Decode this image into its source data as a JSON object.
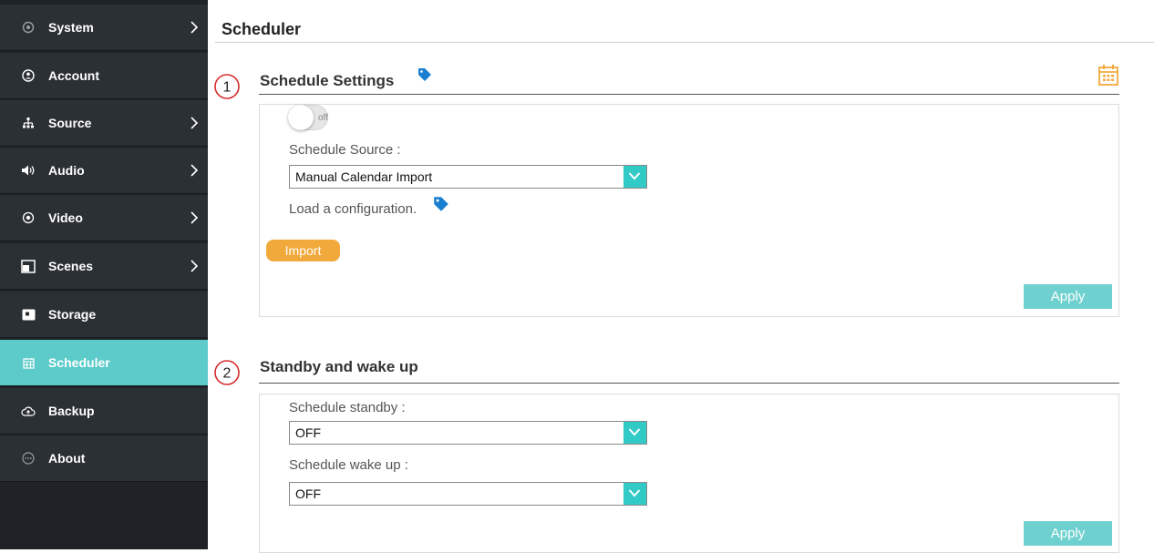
{
  "sidebar": {
    "items": [
      {
        "label": "System",
        "icon": "system-icon",
        "has_submenu": true,
        "active": false
      },
      {
        "label": "Account",
        "icon": "account-icon",
        "has_submenu": false,
        "active": false
      },
      {
        "label": "Source",
        "icon": "source-icon",
        "has_submenu": true,
        "active": false
      },
      {
        "label": "Audio",
        "icon": "audio-icon",
        "has_submenu": true,
        "active": false
      },
      {
        "label": "Video",
        "icon": "video-icon",
        "has_submenu": true,
        "active": false
      },
      {
        "label": "Scenes",
        "icon": "scenes-icon",
        "has_submenu": true,
        "active": false
      },
      {
        "label": "Storage",
        "icon": "storage-icon",
        "has_submenu": false,
        "active": false
      },
      {
        "label": "Scheduler",
        "icon": "scheduler-icon",
        "has_submenu": false,
        "active": true
      },
      {
        "label": "Backup",
        "icon": "backup-icon",
        "has_submenu": false,
        "active": false
      },
      {
        "label": "About",
        "icon": "about-icon",
        "has_submenu": false,
        "active": false
      }
    ]
  },
  "page": {
    "title": "Scheduler"
  },
  "schedule_settings": {
    "step": "1",
    "title": "Schedule Settings",
    "toggle_state": "off",
    "source_label": "Schedule Source :",
    "source_value": "Manual Calendar Import",
    "load_text": "Load a configuration.",
    "import_label": "Import",
    "apply_label": "Apply"
  },
  "standby": {
    "step": "2",
    "title": "Standby and wake up",
    "standby_label": "Schedule standby :",
    "standby_value": "OFF",
    "wakeup_label": "Schedule wake up :",
    "wakeup_value": "OFF",
    "apply_label": "Apply"
  },
  "colors": {
    "sidebar_bg": "#2b3035",
    "active_teal": "#5ccbc9",
    "select_arrow": "#31cac6",
    "import_orange": "#f2a93b",
    "tag_blue": "#1a7fd0",
    "step_red": "#d62c2c"
  }
}
